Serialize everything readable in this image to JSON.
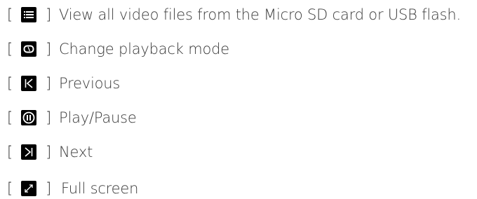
{
  "brackets": {
    "open": "[",
    "close": "]"
  },
  "items": [
    {
      "icon": "list-icon",
      "label": "View all video files from the Micro SD card or USB flash."
    },
    {
      "icon": "repeat-icon",
      "label": "Change playback mode"
    },
    {
      "icon": "previous-icon",
      "label": "Previous"
    },
    {
      "icon": "pause-icon",
      "label": "Play/Pause"
    },
    {
      "icon": "next-icon",
      "label": "Next"
    },
    {
      "icon": "fullscreen-icon",
      "label": "Full screen"
    }
  ]
}
